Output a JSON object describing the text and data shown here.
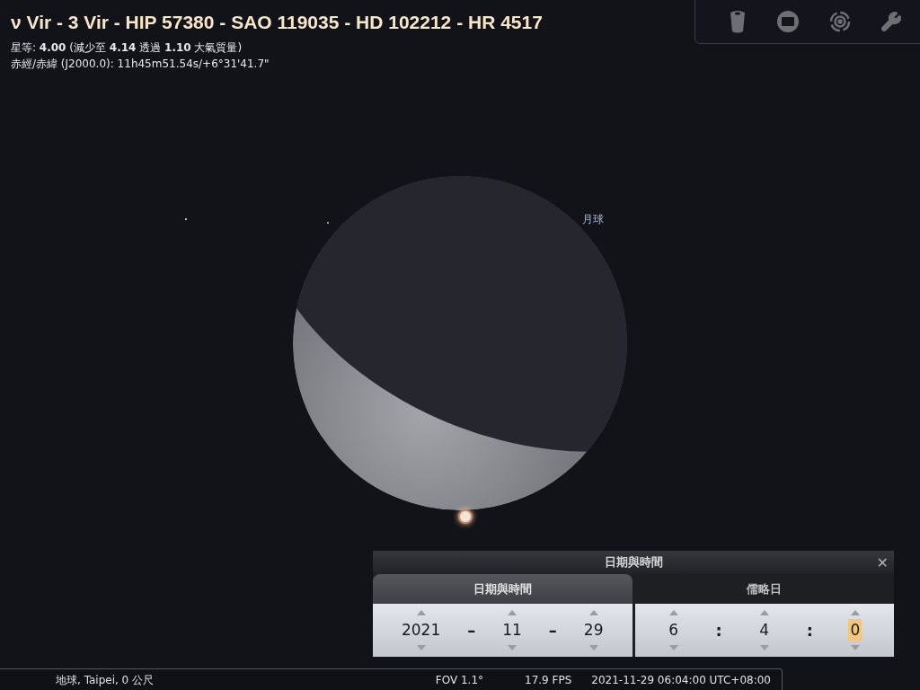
{
  "object_info": {
    "title": "ν Vir - 3 Vir - HIP 57380 - SAO 119035 - HD 102212 - HR 4517",
    "magnitude": "星等: **4.00** (減少至 **4.14** 透過 **1.10** 大氣質量)",
    "coordinates": "赤經/赤緯 (J2000.0): 11h45m51.54s/+6°31'41.7\""
  },
  "moon_label": "月球",
  "dialog": {
    "title": "日期與時間",
    "close": "✕",
    "tabs": [
      {
        "label": "日期與時間",
        "selected": true
      },
      {
        "label": "儒略日",
        "selected": false
      }
    ],
    "date_fields": [
      {
        "kind": "number",
        "text": "2021",
        "selected": false
      },
      {
        "kind": "separator",
        "text": "–"
      },
      {
        "kind": "number",
        "text": "11",
        "selected": false
      },
      {
        "kind": "separator",
        "text": "–"
      },
      {
        "kind": "number",
        "text": "29",
        "selected": false
      }
    ],
    "time_fields": [
      {
        "kind": "number",
        "text": "6",
        "selected": false
      },
      {
        "kind": "separator",
        "text": ":"
      },
      {
        "kind": "number",
        "text": "4",
        "selected": false
      },
      {
        "kind": "separator",
        "text": ":"
      },
      {
        "kind": "number",
        "text": "0",
        "selected": true
      }
    ]
  },
  "status_bar": {
    "location": "地球, Taipei, 0 公尺",
    "fov": "FOV 1.1°",
    "fps": "17.9 FPS",
    "datetime": "2021-11-29 06:04:00 UTC+08:00"
  }
}
